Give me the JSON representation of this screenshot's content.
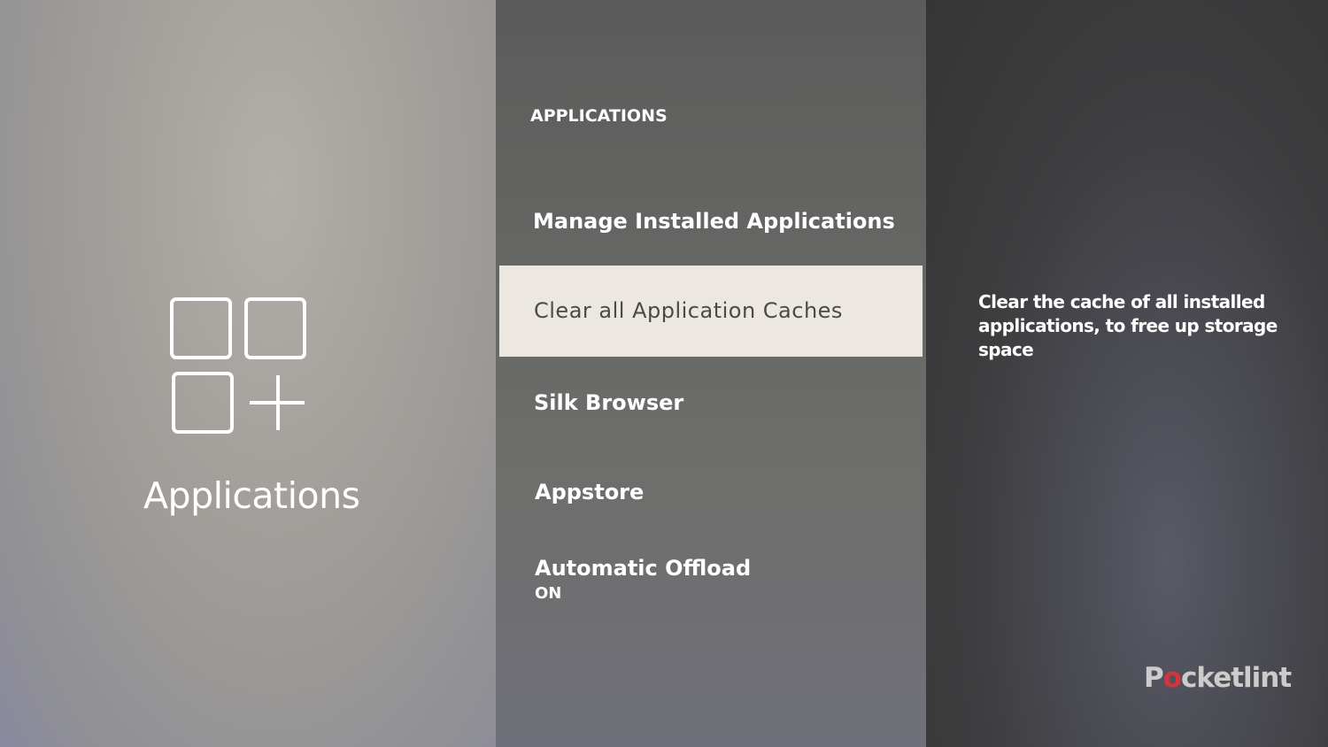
{
  "left": {
    "icon": "apps-grid-plus-icon",
    "label": "Applications"
  },
  "menu": {
    "section_title": "APPLICATIONS",
    "items": [
      {
        "label": "Manage Installed Applications"
      },
      {
        "label": "Clear all Application Caches",
        "selected": true
      },
      {
        "label": "Silk Browser"
      },
      {
        "label": "Appstore"
      },
      {
        "label": "Automatic Offload",
        "sublabel": "ON"
      }
    ]
  },
  "detail": {
    "description": "Clear the cache of all installed applications, to free up storage space"
  },
  "watermark": {
    "prefix": "P",
    "o": "o",
    "suffix": "cketlint"
  },
  "colors": {
    "selected_bg": "#ece8e1",
    "selected_text": "#4a4a4a",
    "text": "#ffffff",
    "watermark_accent": "#e0333a"
  }
}
